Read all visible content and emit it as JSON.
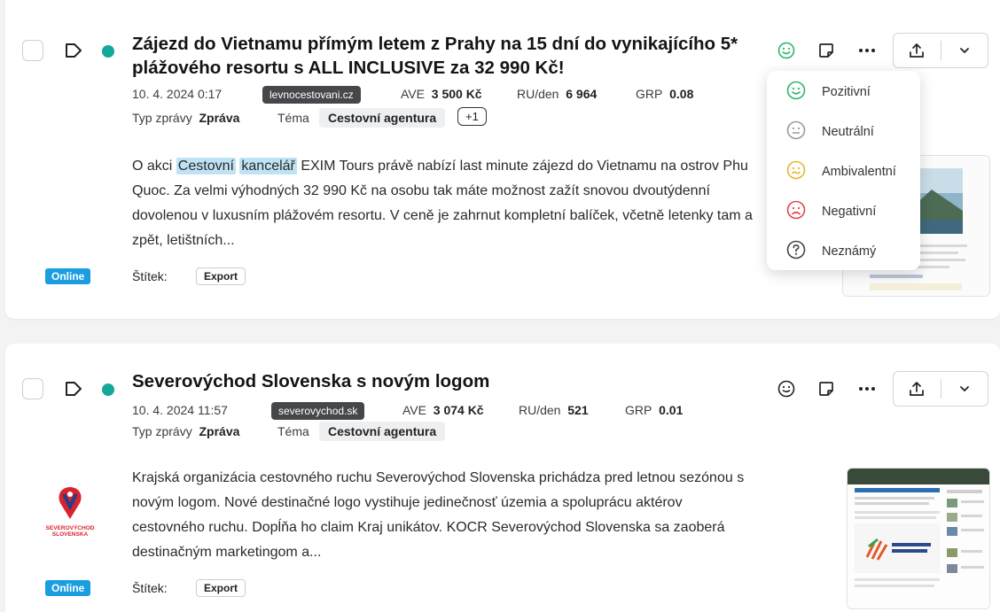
{
  "articles": [
    {
      "title": "Zájezd do Vietnamu přímým letem z Prahy na 15 dní do vynikajícího 5* plážového resortu s ALL INCLUSIVE za 32 990 Kč!",
      "date": "10. 4. 2024 0:17",
      "source": "levnocestovani.cz",
      "ave_label": "AVE",
      "ave_value": "3 500 Kč",
      "ru_label": "RU/den",
      "ru_value": "6 964",
      "grp_label": "GRP",
      "grp_value": "0.08",
      "type_label": "Typ zprávy",
      "type_value": "Zpráva",
      "theme_label": "Téma",
      "theme_value": "Cestovní agentura",
      "extra_themes": "+1",
      "body_pre": "O akci",
      "highlight1": "Cestovní",
      "highlight2": "kancelář",
      "body_post": "EXIM Tours právě nabízí last minute zájezd do Vietnamu na ostrov Phu Quoc. Za velmi výhodných 32 990 Kč na osobu tak máte možnost zažít snovou dvoutýdenní dovolenou v luxusním plážovém resortu. V ceně je zahrnut kompletní balíček, včetně letenky tam a zpět, letištních...",
      "channel": "Online",
      "label_caption": "Štítek:",
      "label_value": "Export"
    },
    {
      "title": "Severovýchod Slovenska s novým logom",
      "date": "10. 4. 2024 11:57",
      "source": "severovychod.sk",
      "ave_label": "AVE",
      "ave_value": "3 074 Kč",
      "ru_label": "RU/den",
      "ru_value": "521",
      "grp_label": "GRP",
      "grp_value": "0.01",
      "type_label": "Typ zprávy",
      "type_value": "Zpráva",
      "theme_label": "Téma",
      "theme_value": "Cestovní agentura",
      "body": "Krajská organizácia cestovného ruchu Severovýchod Slovenska prichádza pred letnou sezónou s novým logom. Nové destinačné logo vystihuje jedinečnosť územia a spoluprácu aktérov cestovného ruchu. Dopĺňa ho claim Kraj unikátov. KOCR Severovýchod Slovenska sa zaoberá destinačným marketingom a...",
      "logo_text_line1": "SEVEROVÝCHOD",
      "logo_text_line2": "SLOVENSKA",
      "channel": "Online",
      "label_caption": "Štítek:",
      "label_value": "Export"
    }
  ],
  "sentiment_menu": {
    "items": [
      {
        "label": "Pozitivní",
        "icon": "smile-icon",
        "color": "#2fb36a"
      },
      {
        "label": "Neutrální",
        "icon": "neutral-face-icon",
        "color": "#9a9a9a"
      },
      {
        "label": "Ambivalentní",
        "icon": "ambivalent-face-icon",
        "color": "#e8b52a"
      },
      {
        "label": "Negativní",
        "icon": "frown-icon",
        "color": "#e0454f"
      },
      {
        "label": "Neznámý",
        "icon": "question-icon",
        "color": "#444444"
      }
    ]
  },
  "colors": {
    "accent_teal": "#14a89a",
    "online_blue": "#1a9ee0",
    "highlight": "#bfe3f4",
    "source_badge": "#45474b"
  }
}
